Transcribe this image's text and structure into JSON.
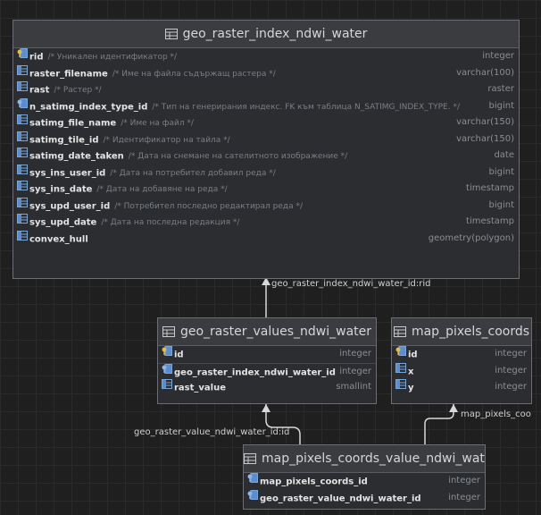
{
  "tables": {
    "index": {
      "title": "geo_raster_index_ndwi_water",
      "columns": [
        {
          "name": "rid",
          "comment": "/* Уникален идентификатор */",
          "type": "integer",
          "icon": "primary-key-icon"
        },
        {
          "name": "raster_filename",
          "comment": "/* Име на файла съдържащ растера */",
          "type": "varchar(100)",
          "icon": "column-icon"
        },
        {
          "name": "rast",
          "comment": "/* Растер */",
          "type": "raster",
          "icon": "column-icon"
        },
        {
          "name": "n_satimg_index_type_id",
          "comment": "/* Тип на генерирания индекс. FK към таблица N_SATIMG_INDEX_TYPE. */",
          "type": "bigint",
          "icon": "foreign-key-icon"
        },
        {
          "name": "satimg_file_name",
          "comment": "/* Име на файл */",
          "type": "varchar(150)",
          "icon": "column-icon"
        },
        {
          "name": "satimg_tile_id",
          "comment": "/* Идентификатор на тайла */",
          "type": "varchar(150)",
          "icon": "column-icon"
        },
        {
          "name": "satimg_date_taken",
          "comment": "/* Дата на снемане на сателитното изображение */",
          "type": "date",
          "icon": "column-icon"
        },
        {
          "name": "sys_ins_user_id",
          "comment": "/* Дата на потребител добавил реда */",
          "type": "bigint",
          "icon": "column-icon"
        },
        {
          "name": "sys_ins_date",
          "comment": "/* Дата на добавяне на реда */",
          "type": "timestamp",
          "icon": "column-icon"
        },
        {
          "name": "sys_upd_user_id",
          "comment": "/* Потребител последно редактирал реда */",
          "type": "bigint",
          "icon": "column-icon"
        },
        {
          "name": "sys_upd_date",
          "comment": "/* Дата на последна редакция */",
          "type": "timestamp",
          "icon": "column-icon"
        },
        {
          "name": "convex_hull",
          "comment": "",
          "type": "geometry(polygon)",
          "icon": "column-icon"
        }
      ]
    },
    "values": {
      "title": "geo_raster_values_ndwi_water",
      "columns": [
        {
          "name": "id",
          "type": "integer",
          "icon": "primary-key-icon"
        },
        {
          "name": "geo_raster_index_ndwi_water_id",
          "type": "integer",
          "icon": "foreign-key-icon"
        },
        {
          "name": "rast_value",
          "type": "smallint",
          "icon": "column-icon"
        }
      ]
    },
    "pixels": {
      "title": "map_pixels_coords",
      "columns": [
        {
          "name": "id",
          "type": "integer",
          "icon": "primary-key-icon"
        },
        {
          "name": "x",
          "type": "integer",
          "icon": "column-icon"
        },
        {
          "name": "y",
          "type": "integer",
          "icon": "column-icon"
        }
      ]
    },
    "link": {
      "title": "map_pixels_coords_value_ndwi_water",
      "columns": [
        {
          "name": "map_pixels_coords_id",
          "type": "integer",
          "icon": "foreign-key-icon"
        },
        {
          "name": "geo_raster_value_ndwi_water_id",
          "type": "integer",
          "icon": "foreign-key-icon"
        }
      ]
    }
  },
  "relations": {
    "index_rel": "geo_raster_index_ndwi_water_id:rid",
    "value_rel": "geo_raster_value_ndwi_water_id:id",
    "pixel_rel": "map_pixels_coo"
  }
}
